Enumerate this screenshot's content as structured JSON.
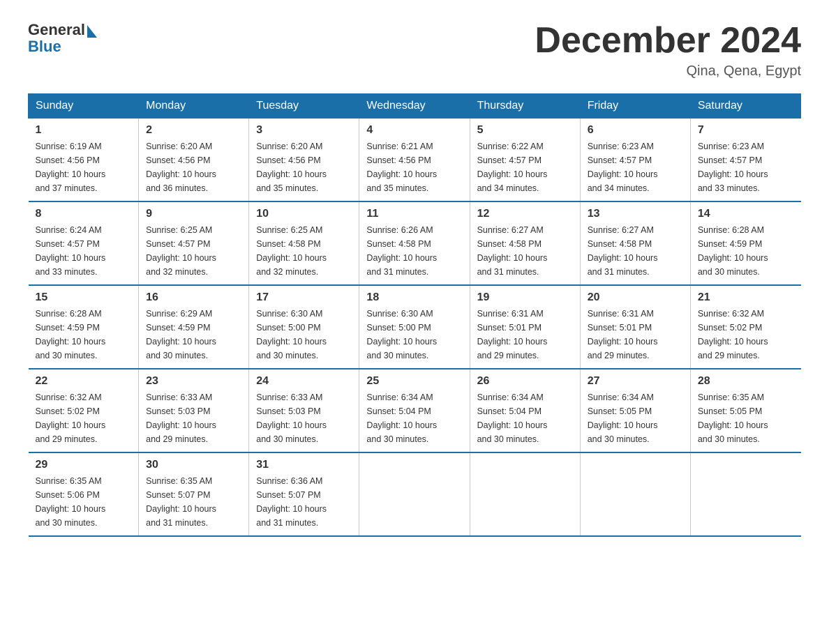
{
  "logo": {
    "general": "General",
    "blue": "Blue"
  },
  "header": {
    "title": "December 2024",
    "location": "Qina, Qena, Egypt"
  },
  "weekdays": [
    "Sunday",
    "Monday",
    "Tuesday",
    "Wednesday",
    "Thursday",
    "Friday",
    "Saturday"
  ],
  "weeks": [
    [
      {
        "day": "1",
        "sunrise": "6:19 AM",
        "sunset": "4:56 PM",
        "daylight": "10 hours and 37 minutes."
      },
      {
        "day": "2",
        "sunrise": "6:20 AM",
        "sunset": "4:56 PM",
        "daylight": "10 hours and 36 minutes."
      },
      {
        "day": "3",
        "sunrise": "6:20 AM",
        "sunset": "4:56 PM",
        "daylight": "10 hours and 35 minutes."
      },
      {
        "day": "4",
        "sunrise": "6:21 AM",
        "sunset": "4:56 PM",
        "daylight": "10 hours and 35 minutes."
      },
      {
        "day": "5",
        "sunrise": "6:22 AM",
        "sunset": "4:57 PM",
        "daylight": "10 hours and 34 minutes."
      },
      {
        "day": "6",
        "sunrise": "6:23 AM",
        "sunset": "4:57 PM",
        "daylight": "10 hours and 34 minutes."
      },
      {
        "day": "7",
        "sunrise": "6:23 AM",
        "sunset": "4:57 PM",
        "daylight": "10 hours and 33 minutes."
      }
    ],
    [
      {
        "day": "8",
        "sunrise": "6:24 AM",
        "sunset": "4:57 PM",
        "daylight": "10 hours and 33 minutes."
      },
      {
        "day": "9",
        "sunrise": "6:25 AM",
        "sunset": "4:57 PM",
        "daylight": "10 hours and 32 minutes."
      },
      {
        "day": "10",
        "sunrise": "6:25 AM",
        "sunset": "4:58 PM",
        "daylight": "10 hours and 32 minutes."
      },
      {
        "day": "11",
        "sunrise": "6:26 AM",
        "sunset": "4:58 PM",
        "daylight": "10 hours and 31 minutes."
      },
      {
        "day": "12",
        "sunrise": "6:27 AM",
        "sunset": "4:58 PM",
        "daylight": "10 hours and 31 minutes."
      },
      {
        "day": "13",
        "sunrise": "6:27 AM",
        "sunset": "4:58 PM",
        "daylight": "10 hours and 31 minutes."
      },
      {
        "day": "14",
        "sunrise": "6:28 AM",
        "sunset": "4:59 PM",
        "daylight": "10 hours and 30 minutes."
      }
    ],
    [
      {
        "day": "15",
        "sunrise": "6:28 AM",
        "sunset": "4:59 PM",
        "daylight": "10 hours and 30 minutes."
      },
      {
        "day": "16",
        "sunrise": "6:29 AM",
        "sunset": "4:59 PM",
        "daylight": "10 hours and 30 minutes."
      },
      {
        "day": "17",
        "sunrise": "6:30 AM",
        "sunset": "5:00 PM",
        "daylight": "10 hours and 30 minutes."
      },
      {
        "day": "18",
        "sunrise": "6:30 AM",
        "sunset": "5:00 PM",
        "daylight": "10 hours and 30 minutes."
      },
      {
        "day": "19",
        "sunrise": "6:31 AM",
        "sunset": "5:01 PM",
        "daylight": "10 hours and 29 minutes."
      },
      {
        "day": "20",
        "sunrise": "6:31 AM",
        "sunset": "5:01 PM",
        "daylight": "10 hours and 29 minutes."
      },
      {
        "day": "21",
        "sunrise": "6:32 AM",
        "sunset": "5:02 PM",
        "daylight": "10 hours and 29 minutes."
      }
    ],
    [
      {
        "day": "22",
        "sunrise": "6:32 AM",
        "sunset": "5:02 PM",
        "daylight": "10 hours and 29 minutes."
      },
      {
        "day": "23",
        "sunrise": "6:33 AM",
        "sunset": "5:03 PM",
        "daylight": "10 hours and 29 minutes."
      },
      {
        "day": "24",
        "sunrise": "6:33 AM",
        "sunset": "5:03 PM",
        "daylight": "10 hours and 30 minutes."
      },
      {
        "day": "25",
        "sunrise": "6:34 AM",
        "sunset": "5:04 PM",
        "daylight": "10 hours and 30 minutes."
      },
      {
        "day": "26",
        "sunrise": "6:34 AM",
        "sunset": "5:04 PM",
        "daylight": "10 hours and 30 minutes."
      },
      {
        "day": "27",
        "sunrise": "6:34 AM",
        "sunset": "5:05 PM",
        "daylight": "10 hours and 30 minutes."
      },
      {
        "day": "28",
        "sunrise": "6:35 AM",
        "sunset": "5:05 PM",
        "daylight": "10 hours and 30 minutes."
      }
    ],
    [
      {
        "day": "29",
        "sunrise": "6:35 AM",
        "sunset": "5:06 PM",
        "daylight": "10 hours and 30 minutes."
      },
      {
        "day": "30",
        "sunrise": "6:35 AM",
        "sunset": "5:07 PM",
        "daylight": "10 hours and 31 minutes."
      },
      {
        "day": "31",
        "sunrise": "6:36 AM",
        "sunset": "5:07 PM",
        "daylight": "10 hours and 31 minutes."
      },
      null,
      null,
      null,
      null
    ]
  ],
  "labels": {
    "sunrise": "Sunrise:",
    "sunset": "Sunset:",
    "daylight": "Daylight:"
  }
}
